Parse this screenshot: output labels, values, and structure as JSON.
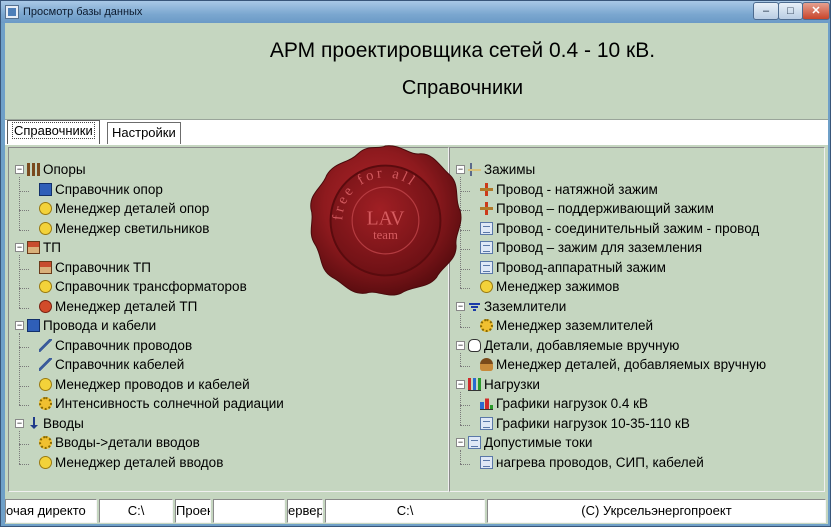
{
  "window": {
    "title": "Просмотр базы данных",
    "controls": {
      "minimize": "–",
      "maximize": "□",
      "close": "✕"
    }
  },
  "header": {
    "title": "АРМ проектировщика сетей 0.4 - 10 кВ.",
    "subtitle": "Справочники"
  },
  "tabs": [
    {
      "label": "Справочники",
      "active": true
    },
    {
      "label": "Настройки",
      "active": false
    }
  ],
  "left_tree": [
    {
      "label": "Опоры",
      "level": 0,
      "expanded": true,
      "icon": "pole-icon"
    },
    {
      "label": "Справочник опор",
      "level": 1,
      "icon": "pole-book-icon"
    },
    {
      "label": "Менеджер деталей опор",
      "level": 1,
      "icon": "smiley-icon"
    },
    {
      "label": "Менеджер светильников",
      "level": 1,
      "icon": "lamp-icon"
    },
    {
      "label": "ТП",
      "level": 0,
      "expanded": true,
      "icon": "substation-icon"
    },
    {
      "label": "Справочник ТП",
      "level": 1,
      "icon": "substation-book-icon"
    },
    {
      "label": "Справочник трансформаторов",
      "level": 1,
      "icon": "smiley-icon"
    },
    {
      "label": "Менеджер деталей ТП",
      "level": 1,
      "icon": "red-smiley-icon"
    },
    {
      "label": "Провода и кабели",
      "level": 0,
      "expanded": true,
      "icon": "wire-book-icon"
    },
    {
      "label": "Справочник проводов",
      "level": 1,
      "icon": "wire-icon"
    },
    {
      "label": "Справочник кабелей",
      "level": 1,
      "icon": "cable-icon"
    },
    {
      "label": "Менеджер проводов и кабелей",
      "level": 1,
      "icon": "smiley-icon"
    },
    {
      "label": "Интенсивность солнечной радиации",
      "level": 1,
      "icon": "sun-icon"
    },
    {
      "label": "Вводы",
      "level": 0,
      "expanded": true,
      "icon": "arrow-down-icon"
    },
    {
      "label": "Вводы->детали вводов",
      "level": 1,
      "icon": "gear-icon"
    },
    {
      "label": "Менеджер деталей вводов",
      "level": 1,
      "icon": "smiley-icon"
    }
  ],
  "right_tree": [
    {
      "label": "Зажимы",
      "level": 0,
      "expanded": true,
      "icon": "clamp-group-icon"
    },
    {
      "label": "Провод - натяжной зажим",
      "level": 1,
      "icon": "clamp-icon"
    },
    {
      "label": "Провод – поддерживающий зажим",
      "level": 1,
      "icon": "support-clamp-icon"
    },
    {
      "label": "Провод - соединительный зажим - провод",
      "level": 1,
      "icon": "doc-icon"
    },
    {
      "label": "Провод – зажим для заземления",
      "level": 1,
      "icon": "doc-icon"
    },
    {
      "label": "Провод-аппаратный зажим",
      "level": 1,
      "icon": "doc-icon"
    },
    {
      "label": "Менеджер зажимов",
      "level": 1,
      "icon": "smiley-icon"
    },
    {
      "label": "Заземлители",
      "level": 0,
      "expanded": true,
      "icon": "ground-icon"
    },
    {
      "label": "Менеджер заземлителей",
      "level": 1,
      "icon": "gear-icon"
    },
    {
      "label": "Детали, добавляемые вручную",
      "level": 0,
      "expanded": true,
      "icon": "hand-icon"
    },
    {
      "label": "Менеджер деталей, добавляемых вручную",
      "level": 1,
      "icon": "person-icon"
    },
    {
      "label": "Нагрузки",
      "level": 0,
      "expanded": true,
      "icon": "chart-icon"
    },
    {
      "label": "Графики нагрузок 0.4 кВ",
      "level": 1,
      "icon": "bar-chart-icon"
    },
    {
      "label": "Графики нагрузок 10-35-110 кВ",
      "level": 1,
      "icon": "doc-icon"
    },
    {
      "label": "Допустимые токи",
      "level": 0,
      "expanded": true,
      "icon": "doc-group-icon"
    },
    {
      "label": "нагрева проводов, СИП, кабелей",
      "level": 1,
      "icon": "doc-icon"
    }
  ],
  "seal": {
    "ring_text": "free for all",
    "center_top": "LAV",
    "center_bottom": "team"
  },
  "statusbar": {
    "a": "очая директо",
    "b": "C:\\",
    "c": "Проек",
    "d": "",
    "e": "ервер",
    "f": "C:\\",
    "g": "(С) Укрсельэнергопроект"
  },
  "colors": {
    "client_bg": "#c5d6c0",
    "seal_red": "#8e1a1e"
  }
}
